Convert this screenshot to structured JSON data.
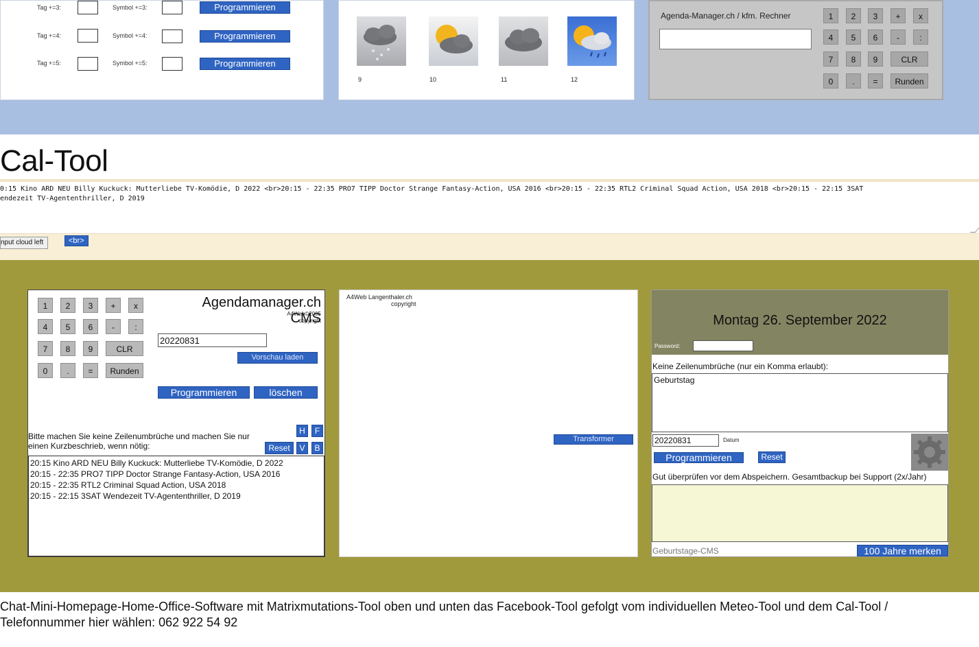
{
  "top_panel_left": {
    "rows": [
      {
        "tag_label": "Tag +=3:",
        "symbol_label": "Symbol +=3:",
        "button": "Programmieren"
      },
      {
        "tag_label": "Tag +=4:",
        "symbol_label": "Symbol +=4:",
        "button": "Programmieren"
      },
      {
        "tag_label": "Tag +=5:",
        "symbol_label": "Symbol +=5:",
        "button": "Programmieren"
      }
    ]
  },
  "weather_panel": {
    "icons": [
      {
        "icon": "snow-cloud-icon",
        "number": "9"
      },
      {
        "icon": "sun-cloud-icon",
        "number": "10"
      },
      {
        "icon": "cloud-icon",
        "number": "11"
      },
      {
        "icon": "sun-rain-icon",
        "number": "12"
      }
    ]
  },
  "top_calculator": {
    "title": "Agenda-Manager.ch / kfm. Rechner",
    "keys": [
      [
        "1",
        "2",
        "3",
        "+",
        "x"
      ],
      [
        "4",
        "5",
        "6",
        "-",
        ":"
      ],
      [
        "7",
        "8",
        "9",
        "CLR"
      ],
      [
        "0",
        ".",
        "=",
        "Runden"
      ]
    ]
  },
  "cal_tool": {
    "title": "Cal-Tool",
    "textarea": "0:15 Kino ARD NEU Billy Kuckuck: Mutterliebe TV-Komödie, D 2022 <br>20:15 - 22:35 PRO7 TIPP Doctor Strange Fantasy-Action, USA 2016 <br>20:15 - 22:35 RTL2 Criminal Squad Action, USA 2018 <br>20:15 - 22:15 3SAT\nendezeit TV-Agententhriller, D 2019",
    "cloud_button": "nput cloud left",
    "br_tag": "<br>"
  },
  "cms": {
    "keys": [
      [
        "1",
        "2",
        "3",
        "+",
        "x"
      ],
      [
        "4",
        "5",
        "6",
        "-",
        ":"
      ],
      [
        "7",
        "8",
        "9",
        "CLR"
      ],
      [
        "0",
        ".",
        "=",
        "Runden"
      ]
    ],
    "title": "Agendamanager.ch CMS",
    "subtitle": "A4Web©2005",
    "copyright": "copyright",
    "date_value": "20220831",
    "preview_button": "Vorschau laden",
    "program_button": "Programmieren",
    "delete_button": "löschen",
    "hint": "Bitte machen Sie keine Zeilenumbrüche und machen Sie nur einen Kurzbeschrieb, wenn nötig:",
    "reset_button": "Reset",
    "h_button": "H",
    "f_button": "F",
    "v_button": "V",
    "b_button": "B",
    "entries": [
      "20:15 Kino ARD NEU Billy Kuckuck: Mutterliebe TV-Komödie, D 2022",
      "20:15 - 22:35 PRO7 TIPP Doctor Strange Fantasy-Action, USA 2016",
      "20:15 - 22:35 RTL2 Criminal Squad Action, USA 2018",
      "20:15 - 22:15 3SAT Wendezeit TV-Agententhriller, D 2019"
    ]
  },
  "preview": {
    "brand": "A4Web Langenthaler.ch",
    "copyright": "copyright",
    "transform_button": "Transformer"
  },
  "birthday": {
    "date_heading": "Montag 26. September 2022",
    "password_label": "Password:",
    "instruction": "Keine Zeilenumbrüche (nur ein Komma erlaubt):",
    "text_value": "Geburtstag",
    "date_value": "20220831",
    "date_label": "Datum",
    "program_button": "Programmieren",
    "reset_button": "Reset",
    "note": "Gut überprüfen vor dem Abspeichern. Gesamtbackup bei Support (2x/Jahr)",
    "footer_label": "Geburtstage-CMS",
    "footer_button": "100 Jahre merken"
  },
  "footer": {
    "line1": "Chat-Mini-Homepage-Home-Office-Software mit Matrixmutations-Tool oben und unten das Facebook-Tool gefolgt vom individuellen Meteo-Tool und dem Cal-Tool /",
    "line2": "Telefonnummer hier wählen: 062 922 54 92"
  }
}
